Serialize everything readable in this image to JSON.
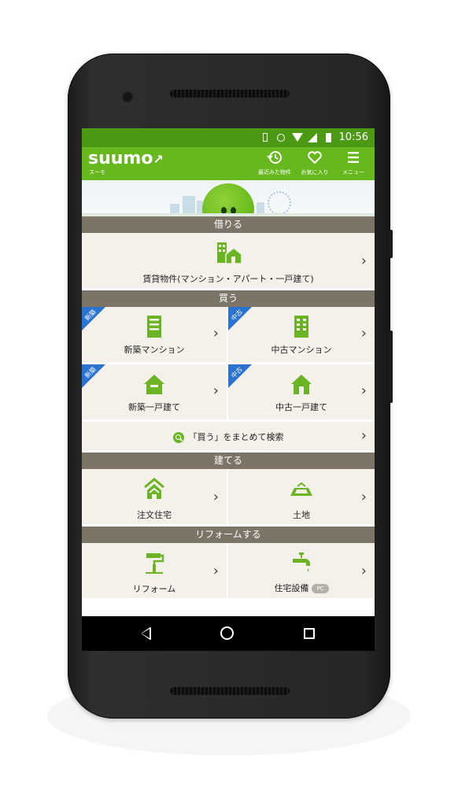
{
  "status_bar": {
    "time": "10:56"
  },
  "app_bar": {
    "logo": "suumo",
    "logo_sub": "スーモ",
    "recent_label": "最近みた物件",
    "favorites_label": "お気に入り",
    "menu_label": "メニュー"
  },
  "sections": {
    "rent": {
      "header": "借りる",
      "rental_label": "賃貸物件(マンション・アパート・一戸建て)"
    },
    "buy": {
      "header": "買う",
      "new_mansion": {
        "label": "新築マンション",
        "badge": "新築"
      },
      "used_mansion": {
        "label": "中古マンション",
        "badge": "中古"
      },
      "new_house": {
        "label": "新築一戸建て",
        "badge": "新築"
      },
      "used_house": {
        "label": "中古一戸建て",
        "badge": "中古"
      },
      "search_all": "「買う」をまとめて検索"
    },
    "build": {
      "header": "建てる",
      "custom_home": "注文住宅",
      "land": "土地"
    },
    "reform": {
      "header": "リフォームする",
      "reform": "リフォーム",
      "equipment": "住宅設備",
      "pc_badge": "PC"
    }
  },
  "colors": {
    "accent_green": "#67b81e",
    "status_green": "#4c9a13",
    "section_header": "#7d7468",
    "tile_bg": "#f4f1ea",
    "badge_blue": "#2a73d1"
  },
  "icons": {
    "recent": "history-icon",
    "favorites": "heart-icon",
    "menu": "hamburger-icon",
    "chevron": "chevron-right-icon"
  }
}
